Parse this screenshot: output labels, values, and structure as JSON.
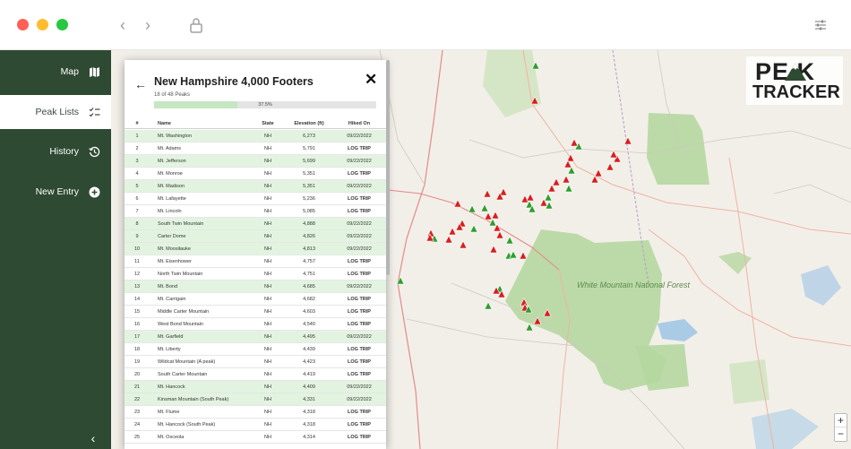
{
  "window": {
    "back_glyph": "‹",
    "forward_glyph": "›"
  },
  "sidebar": {
    "items": [
      {
        "label": "Map",
        "icon": "map-icon"
      },
      {
        "label": "Peak Lists",
        "icon": "checklist-icon"
      },
      {
        "label": "History",
        "icon": "history-icon"
      },
      {
        "label": "New Entry",
        "icon": "plus-circle-icon"
      }
    ],
    "active": "Peak Lists",
    "collapse_glyph": "‹"
  },
  "logo": {
    "line1": "PE K",
    "line2": "TRACKER"
  },
  "map": {
    "zoom_in": "+",
    "zoom_out": "−",
    "labels": [
      "White Mountain National Forest"
    ],
    "colors": {
      "hiked": "#2e9e2e",
      "not_hiked": "#d81e1e",
      "forest": "#b5d7a0"
    }
  },
  "panel": {
    "back_glyph": "←",
    "title": "New Hampshire 4,000 Footers",
    "close_glyph": "✕",
    "progress_text": "18 of 48 Peaks",
    "progress_percent_label": "37.5%",
    "progress_fraction": 0.375,
    "columns": [
      "#",
      "Name",
      "State",
      "Elevation (ft)",
      "Hiked On"
    ],
    "rows": [
      {
        "num": "1",
        "name": "Mt. Washington",
        "state": "NH",
        "elev": "6,273",
        "hiked": "09/22/2022"
      },
      {
        "num": "2",
        "name": "Mt. Adams",
        "state": "NH",
        "elev": "5,791",
        "hiked": "LOG TRIP"
      },
      {
        "num": "3",
        "name": "Mt. Jefferson",
        "state": "NH",
        "elev": "5,699",
        "hiked": "09/22/2022"
      },
      {
        "num": "4",
        "name": "Mt. Monroe",
        "state": "NH",
        "elev": "5,351",
        "hiked": "LOG TRIP"
      },
      {
        "num": "5",
        "name": "Mt. Madison",
        "state": "NH",
        "elev": "5,351",
        "hiked": "09/22/2022"
      },
      {
        "num": "6",
        "name": "Mt. Lafayette",
        "state": "NH",
        "elev": "5,236",
        "hiked": "LOG TRIP"
      },
      {
        "num": "7",
        "name": "Mt. Lincoln",
        "state": "NH",
        "elev": "5,085",
        "hiked": "LOG TRIP"
      },
      {
        "num": "8",
        "name": "South Twin Mountain",
        "state": "NH",
        "elev": "4,888",
        "hiked": "09/22/2022"
      },
      {
        "num": "9",
        "name": "Carter Dome",
        "state": "NH",
        "elev": "4,826",
        "hiked": "09/22/2022"
      },
      {
        "num": "10",
        "name": "Mt. Moosilauke",
        "state": "NH",
        "elev": "4,813",
        "hiked": "09/22/2022"
      },
      {
        "num": "11",
        "name": "Mt. Eisenhower",
        "state": "NH",
        "elev": "4,757",
        "hiked": "LOG TRIP"
      },
      {
        "num": "12",
        "name": "North Twin Mountain",
        "state": "NH",
        "elev": "4,751",
        "hiked": "LOG TRIP"
      },
      {
        "num": "13",
        "name": "Mt. Bond",
        "state": "NH",
        "elev": "4,685",
        "hiked": "09/22/2022"
      },
      {
        "num": "14",
        "name": "Mt. Carrigain",
        "state": "NH",
        "elev": "4,682",
        "hiked": "LOG TRIP"
      },
      {
        "num": "15",
        "name": "Middle Carter Mountain",
        "state": "NH",
        "elev": "4,603",
        "hiked": "LOG TRIP"
      },
      {
        "num": "16",
        "name": "West Bond Mountain",
        "state": "NH",
        "elev": "4,540",
        "hiked": "LOG TRIP"
      },
      {
        "num": "17",
        "name": "Mt. Garfield",
        "state": "NH",
        "elev": "4,495",
        "hiked": "09/22/2022"
      },
      {
        "num": "18",
        "name": "Mt. Liberty",
        "state": "NH",
        "elev": "4,439",
        "hiked": "LOG TRIP"
      },
      {
        "num": "19",
        "name": "Wildcat Mountain (A peak)",
        "state": "NH",
        "elev": "4,423",
        "hiked": "LOG TRIP"
      },
      {
        "num": "20",
        "name": "South Carter Mountain",
        "state": "NH",
        "elev": "4,419",
        "hiked": "LOG TRIP"
      },
      {
        "num": "21",
        "name": "Mt. Hancock",
        "state": "NH",
        "elev": "4,409",
        "hiked": "09/22/2022"
      },
      {
        "num": "22",
        "name": "Kinsman Mountain (South Peak)",
        "state": "NH",
        "elev": "4,331",
        "hiked": "09/22/2022"
      },
      {
        "num": "23",
        "name": "Mt. Flume",
        "state": "NH",
        "elev": "4,318",
        "hiked": "LOG TRIP"
      },
      {
        "num": "24",
        "name": "Mt. Hancock (South Peak)",
        "state": "NH",
        "elev": "4,318",
        "hiked": "LOG TRIP"
      },
      {
        "num": "25",
        "name": "Mt. Osceola",
        "state": "NH",
        "elev": "4,314",
        "hiked": "LOG TRIP"
      }
    ]
  }
}
